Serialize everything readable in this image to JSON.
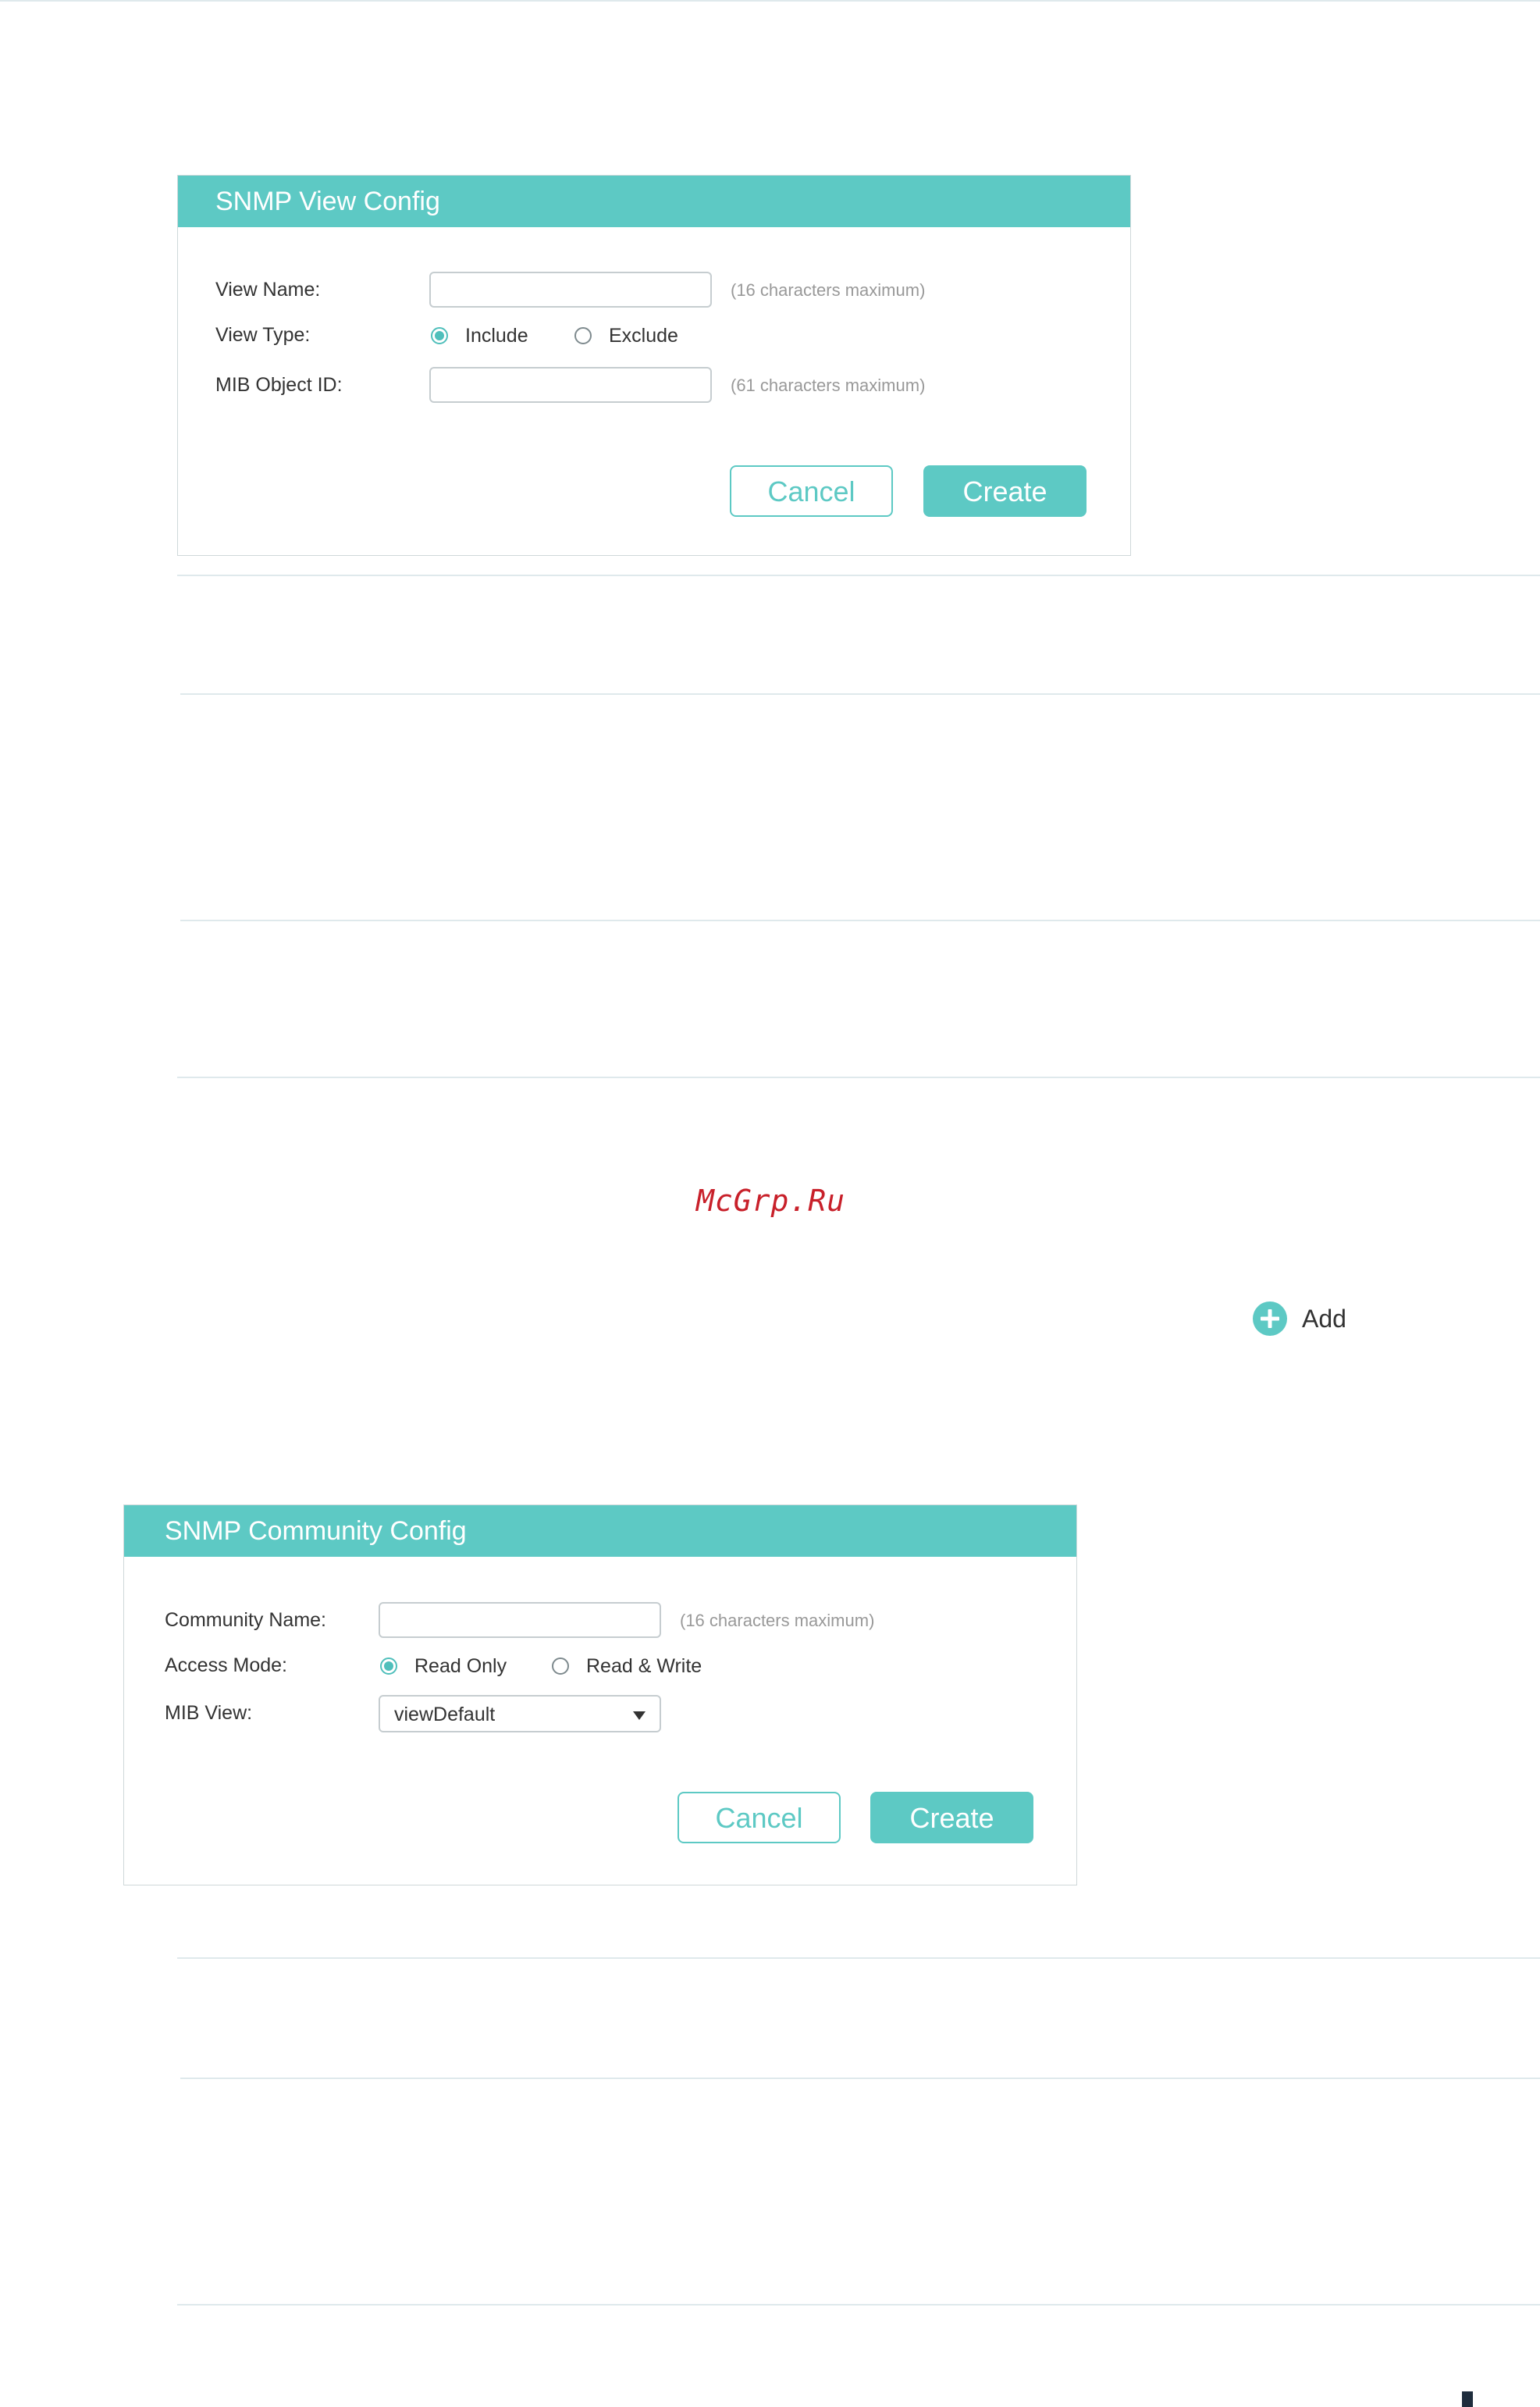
{
  "view_config": {
    "title": "SNMP View Config",
    "view_name_label": "View Name:",
    "view_name_value": "",
    "view_name_hint": "(16 characters maximum)",
    "view_type_label": "View Type:",
    "view_type_options": [
      {
        "label": "Include",
        "checked": true
      },
      {
        "label": "Exclude",
        "checked": false
      }
    ],
    "mib_object_label": "MIB Object ID:",
    "mib_object_value": "",
    "mib_object_hint": "(61 characters maximum)",
    "cancel_label": "Cancel",
    "create_label": "Create"
  },
  "watermark": "McGrp.Ru",
  "add_button": {
    "label": "Add",
    "icon": "plus-circle-icon"
  },
  "community_config": {
    "title": "SNMP Community Config",
    "community_name_label": "Community Name:",
    "community_name_value": "",
    "community_name_hint": "(16 characters maximum)",
    "access_mode_label": "Access Mode:",
    "access_mode_options": [
      {
        "label": "Read Only",
        "checked": true
      },
      {
        "label": "Read & Write",
        "checked": false
      }
    ],
    "mib_view_label": "MIB View:",
    "mib_view_selected": "viewDefault",
    "cancel_label": "Cancel",
    "create_label": "Create"
  },
  "colors": {
    "accent": "#5dc9c4",
    "divider": "#dfe9ec",
    "watermark": "#c8202a"
  }
}
